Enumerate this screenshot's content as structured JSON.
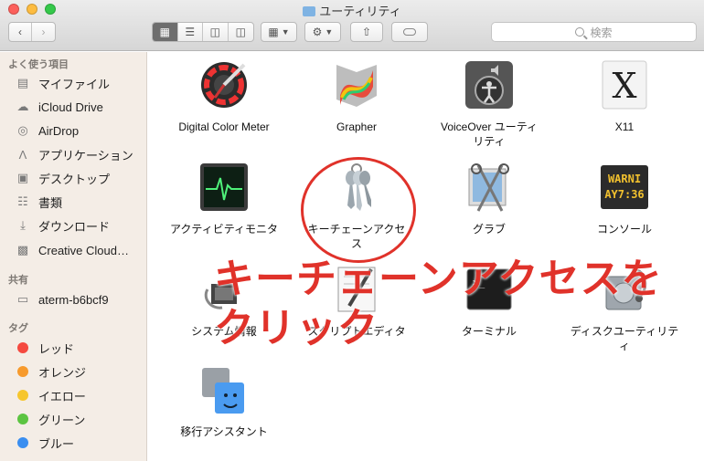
{
  "window": {
    "title": "ユーティリティ"
  },
  "toolbar": {
    "back_icon": "chevron-left-icon",
    "forward_icon": "chevron-right-icon",
    "view_modes": [
      "icon-view",
      "list-view",
      "column-view",
      "coverflow-view"
    ],
    "active_view": "icon-view",
    "search_placeholder": "検索"
  },
  "sidebar": {
    "favorites_header": "よく使う項目",
    "favorites": [
      {
        "label": "マイファイル",
        "icon": "all-files-icon"
      },
      {
        "label": "iCloud Drive",
        "icon": "cloud-icon"
      },
      {
        "label": "AirDrop",
        "icon": "airdrop-icon"
      },
      {
        "label": "アプリケーション",
        "icon": "applications-icon"
      },
      {
        "label": "デスクトップ",
        "icon": "desktop-icon"
      },
      {
        "label": "書類",
        "icon": "documents-icon"
      },
      {
        "label": "ダウンロード",
        "icon": "downloads-icon"
      },
      {
        "label": "Creative Cloud…",
        "icon": "folder-icon"
      }
    ],
    "shared_header": "共有",
    "shared": [
      {
        "label": "aterm-b6bcf9",
        "icon": "network-computer-icon"
      }
    ],
    "tags_header": "タグ",
    "tags": [
      {
        "label": "レッド",
        "color": "#f5493f"
      },
      {
        "label": "オレンジ",
        "color": "#f79a2c"
      },
      {
        "label": "イエロー",
        "color": "#f6c62d"
      },
      {
        "label": "グリーン",
        "color": "#5cc441"
      },
      {
        "label": "ブルー",
        "color": "#3a8ef0"
      }
    ]
  },
  "apps": [
    {
      "label": "Digital Color Meter",
      "icon": "digital-color-meter-icon"
    },
    {
      "label": "Grapher",
      "icon": "grapher-icon"
    },
    {
      "label": "VoiceOver ユーティリティ",
      "icon": "voiceover-icon"
    },
    {
      "label": "X11",
      "icon": "x11-icon"
    },
    {
      "label": "アクティビティモニタ",
      "icon": "activity-monitor-icon"
    },
    {
      "label": "キーチェーンアクセス",
      "icon": "keychain-icon"
    },
    {
      "label": "グラブ",
      "icon": "grab-icon"
    },
    {
      "label": "コンソール",
      "icon": "console-icon"
    },
    {
      "label": "システム情報",
      "icon": "system-information-icon"
    },
    {
      "label": "スクリプトエディタ",
      "icon": "script-editor-icon"
    },
    {
      "label": "ターミナル",
      "icon": "terminal-icon"
    },
    {
      "label": "ディスクユーティリティ",
      "icon": "disk-utility-icon"
    },
    {
      "label": "移行アシスタント",
      "icon": "migration-assistant-icon"
    }
  ],
  "annotation": {
    "text": "キーチェーンアクセスをクリック",
    "color": "#e0322a"
  }
}
